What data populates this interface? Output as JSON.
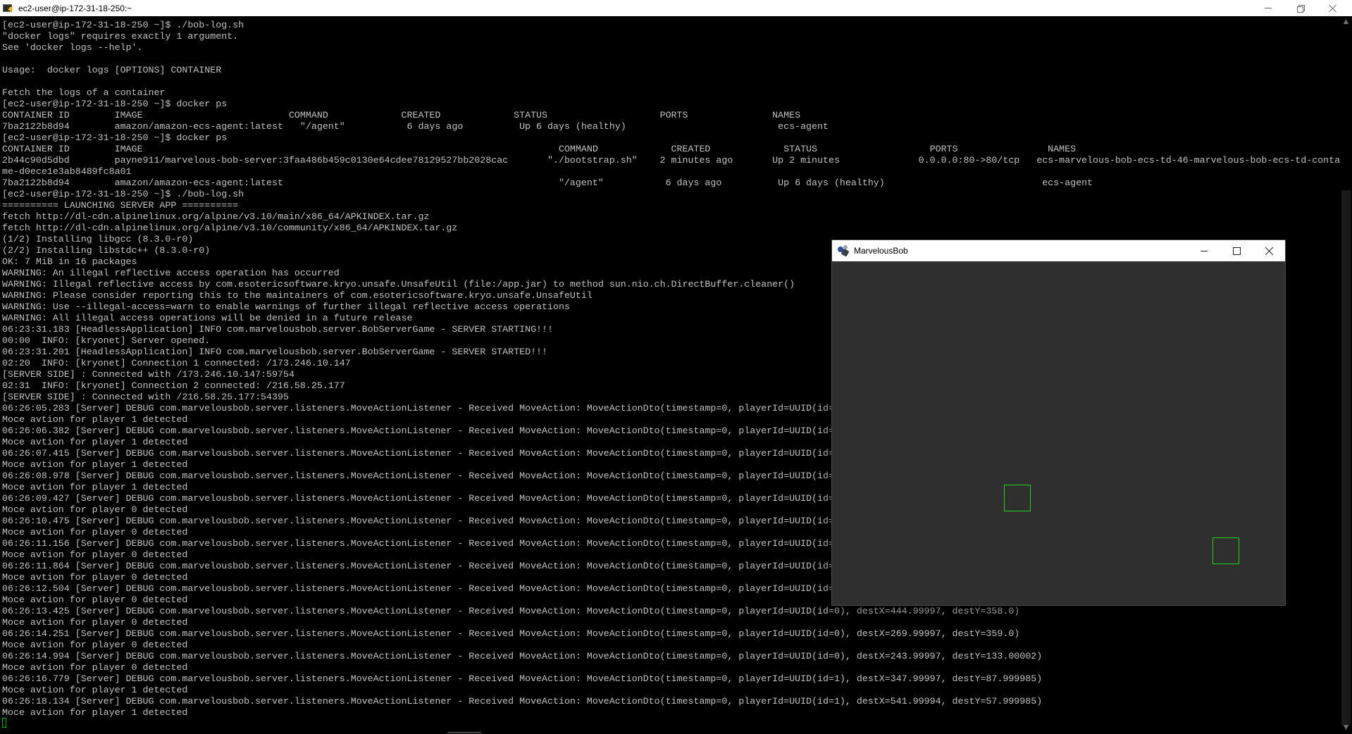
{
  "terminal": {
    "title": "ec2-user@ip-172-31-18-250:~",
    "lines": [
      "[ec2-user@ip-172-31-18-250 ~]$ ./bob-log.sh",
      "\"docker logs\" requires exactly 1 argument.",
      "See 'docker logs --help'.",
      "",
      "Usage:  docker logs [OPTIONS] CONTAINER",
      "",
      "Fetch the logs of a container",
      "[ec2-user@ip-172-31-18-250 ~]$ docker ps",
      "CONTAINER ID        IMAGE                          COMMAND             CREATED             STATUS                    PORTS               NAMES",
      "7ba2122b8d94        amazon/amazon-ecs-agent:latest   \"/agent\"           6 days ago          Up 6 days (healthy)                           ecs-agent",
      "[ec2-user@ip-172-31-18-250 ~]$ docker ps",
      "CONTAINER ID        IMAGE                                                                          COMMAND             CREATED             STATUS                    PORTS                NAMES",
      "2b44c90d5dbd        payne911/marvelous-bob-server:3faa486b459c0130e64cdee78129527bb2028cac       \"./bootstrap.sh\"    2 minutes ago       Up 2 minutes              0.0.0.0:80->80/tcp   ecs-marvelous-bob-ecs-td-46-marvelous-bob-ecs-td-container-na",
      "me-d0ece1e3ab8489fc8a01",
      "7ba2122b8d94        amazon/amazon-ecs-agent:latest                                                 \"/agent\"           6 days ago          Up 6 days (healthy)                            ecs-agent",
      "[ec2-user@ip-172-31-18-250 ~]$ ./bob-log.sh",
      "========== LAUNCHING SERVER APP ==========",
      "fetch http://dl-cdn.alpinelinux.org/alpine/v3.10/main/x86_64/APKINDEX.tar.gz",
      "fetch http://dl-cdn.alpinelinux.org/alpine/v3.10/community/x86_64/APKINDEX.tar.gz",
      "(1/2) Installing libgcc (8.3.0-r0)",
      "(2/2) Installing libstdc++ (8.3.0-r0)",
      "OK: 7 MiB in 16 packages",
      "WARNING: An illegal reflective access operation has occurred",
      "WARNING: Illegal reflective access by com.esotericsoftware.kryo.unsafe.UnsafeUtil (file:/app.jar) to method sun.nio.ch.DirectBuffer.cleaner()",
      "WARNING: Please consider reporting this to the maintainers of com.esotericsoftware.kryo.unsafe.UnsafeUtil",
      "WARNING: Use --illegal-access=warn to enable warnings of further illegal reflective access operations",
      "WARNING: All illegal access operations will be denied in a future release",
      "06:23:31.183 [HeadlessApplication] INFO com.marvelousbob.server.BobServerGame - SERVER STARTING!!!",
      "00:00  INFO: [kryonet] Server opened.",
      "06:23:31.201 [HeadlessApplication] INFO com.marvelousbob.server.BobServerGame - SERVER STARTED!!!",
      "02:20  INFO: [kryonet] Connection 1 connected: /173.246.10.147",
      "[SERVER SIDE] : Connected with /173.246.10.147:59754",
      "02:31  INFO: [kryonet] Connection 2 connected: /216.58.25.177",
      "[SERVER SIDE] : Connected with /216.58.25.177:54395",
      "06:26:05.283 [Server] DEBUG com.marvelousbob.server.listeners.MoveActionListener - Received MoveAction: MoveActionDto(timestamp=0, playerId=UUID(id=",
      "Moce avtion for player 1 detected",
      "06:26:06.382 [Server] DEBUG com.marvelousbob.server.listeners.MoveActionListener - Received MoveAction: MoveActionDto(timestamp=0, playerId=UUID(id=",
      "Moce avtion for player 1 detected",
      "06:26:07.415 [Server] DEBUG com.marvelousbob.server.listeners.MoveActionListener - Received MoveAction: MoveActionDto(timestamp=0, playerId=UUID(id=",
      "Moce avtion for player 1 detected",
      "06:26:08.978 [Server] DEBUG com.marvelousbob.server.listeners.MoveActionListener - Received MoveAction: MoveActionDto(timestamp=0, playerId=UUID(id=",
      "Moce avtion for player 1 detected",
      "06:26:09.427 [Server] DEBUG com.marvelousbob.server.listeners.MoveActionListener - Received MoveAction: MoveActionDto(timestamp=0, playerId=UUID(id=",
      "Moce avtion for player 0 detected",
      "06:26:10.475 [Server] DEBUG com.marvelousbob.server.listeners.MoveActionListener - Received MoveAction: MoveActionDto(timestamp=0, playerId=UUID(id=",
      "Moce avtion for player 0 detected",
      "06:26:11.156 [Server] DEBUG com.marvelousbob.server.listeners.MoveActionListener - Received MoveAction: MoveActionDto(timestamp=0, playerId=UUID(id=",
      "Moce avtion for player 0 detected",
      "06:26:11.864 [Server] DEBUG com.marvelousbob.server.listeners.MoveActionListener - Received MoveAction: MoveActionDto(timestamp=0, playerId=UUID(id=",
      "Moce avtion for player 0 detected",
      "06:26:12.504 [Server] DEBUG com.marvelousbob.server.listeners.MoveActionListener - Received MoveAction: MoveActionDto(timestamp=0, playerId=UUID(id=",
      "Moce avtion for player 0 detected",
      "06:26:13.425 [Server] DEBUG com.marvelousbob.server.listeners.MoveActionListener - Received MoveAction: MoveActionDto(timestamp=0, playerId=UUID(id=0), destX=444.99997, destY=358.0)",
      "Moce avtion for player 0 detected",
      "06:26:14.251 [Server] DEBUG com.marvelousbob.server.listeners.MoveActionListener - Received MoveAction: MoveActionDto(timestamp=0, playerId=UUID(id=0), destX=269.99997, destY=359.0)",
      "Moce avtion for player 0 detected",
      "06:26:14.994 [Server] DEBUG com.marvelousbob.server.listeners.MoveActionListener - Received MoveAction: MoveActionDto(timestamp=0, playerId=UUID(id=0), destX=243.99997, destY=133.00002)",
      "Moce avtion for player 0 detected",
      "06:26:16.779 [Server] DEBUG com.marvelousbob.server.listeners.MoveActionListener - Received MoveAction: MoveActionDto(timestamp=0, playerId=UUID(id=1), destX=347.99997, destY=87.999985)",
      "Moce avtion for player 1 detected",
      "06:26:18.134 [Server] DEBUG com.marvelousbob.server.listeners.MoveActionListener - Received MoveAction: MoveActionDto(timestamp=0, playerId=UUID(id=1), destX=541.99994, destY=57.999985)",
      "Moce avtion for player 1 detected"
    ]
  },
  "game": {
    "title": "MarvelousBob",
    "player_color": "#1fd31f",
    "background_color": "#2f2f2f"
  },
  "icons": {
    "terminal_app": "putty-icon",
    "game_app": "marvelousbob-icon"
  }
}
